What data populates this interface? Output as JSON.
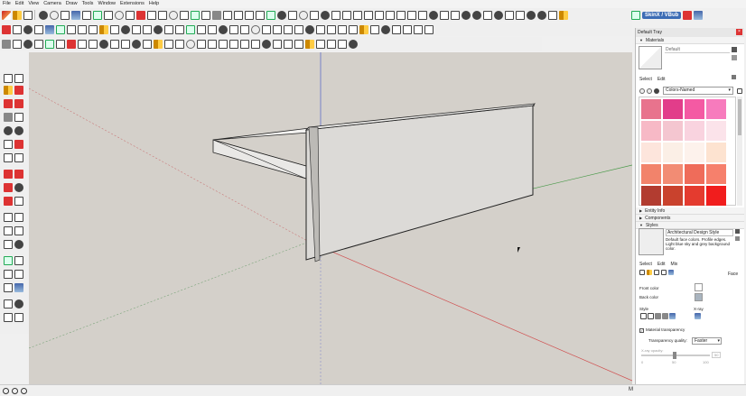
{
  "menu": [
    "File",
    "Edit",
    "View",
    "Camera",
    "Draw",
    "Tools",
    "Window",
    "Extensions",
    "Help"
  ],
  "brand": {
    "label": "SkinX / VBub"
  },
  "status": {
    "left_marker": "M"
  },
  "tray": {
    "title": "Default Tray",
    "materials": {
      "section": "Materials",
      "current_name": "Default",
      "tabs": [
        "Select",
        "Edit"
      ],
      "library": "Colors-Named",
      "swatches": [
        "#e8738d",
        "#e23d8a",
        "#f45aa3",
        "#f77bbd",
        "#f7b9c6",
        "#f4c6d0",
        "#f9d3df",
        "#fbe3ea",
        "#fde5dc",
        "#fbefe6",
        "#fdf2ec",
        "#fde3d0",
        "#f2836b",
        "#f28c74",
        "#ef6c5a",
        "#f6806c",
        "#b23c30",
        "#c9422d",
        "#e43b2f",
        "#f11d1d"
      ]
    },
    "sections": {
      "entity_info": "Entity Info",
      "components": "Components",
      "styles": "Styles"
    },
    "styles": {
      "name": "Architectural Design Style",
      "description": "Default face colors. Profile edges. Light blue sky and grey background color.",
      "tabs": [
        "Select",
        "Edit",
        "Mix"
      ],
      "face_label": "Face",
      "front_color_label": "Front color",
      "back_color_label": "Back color",
      "style_label": "Style",
      "xray_label": "X-ray",
      "material_transparency": "Material transparency",
      "quality_label": "Transparency quality:",
      "quality_value": "Faster",
      "xray_opacity_label": "X-ray opacity:",
      "opacity_value": "50",
      "slider_min": "0",
      "slider_mid": "50",
      "slider_max": "100"
    }
  },
  "colors": {
    "front": "#ffffff",
    "back": "#a9b4bf",
    "viewport": "#d4d0ca"
  }
}
